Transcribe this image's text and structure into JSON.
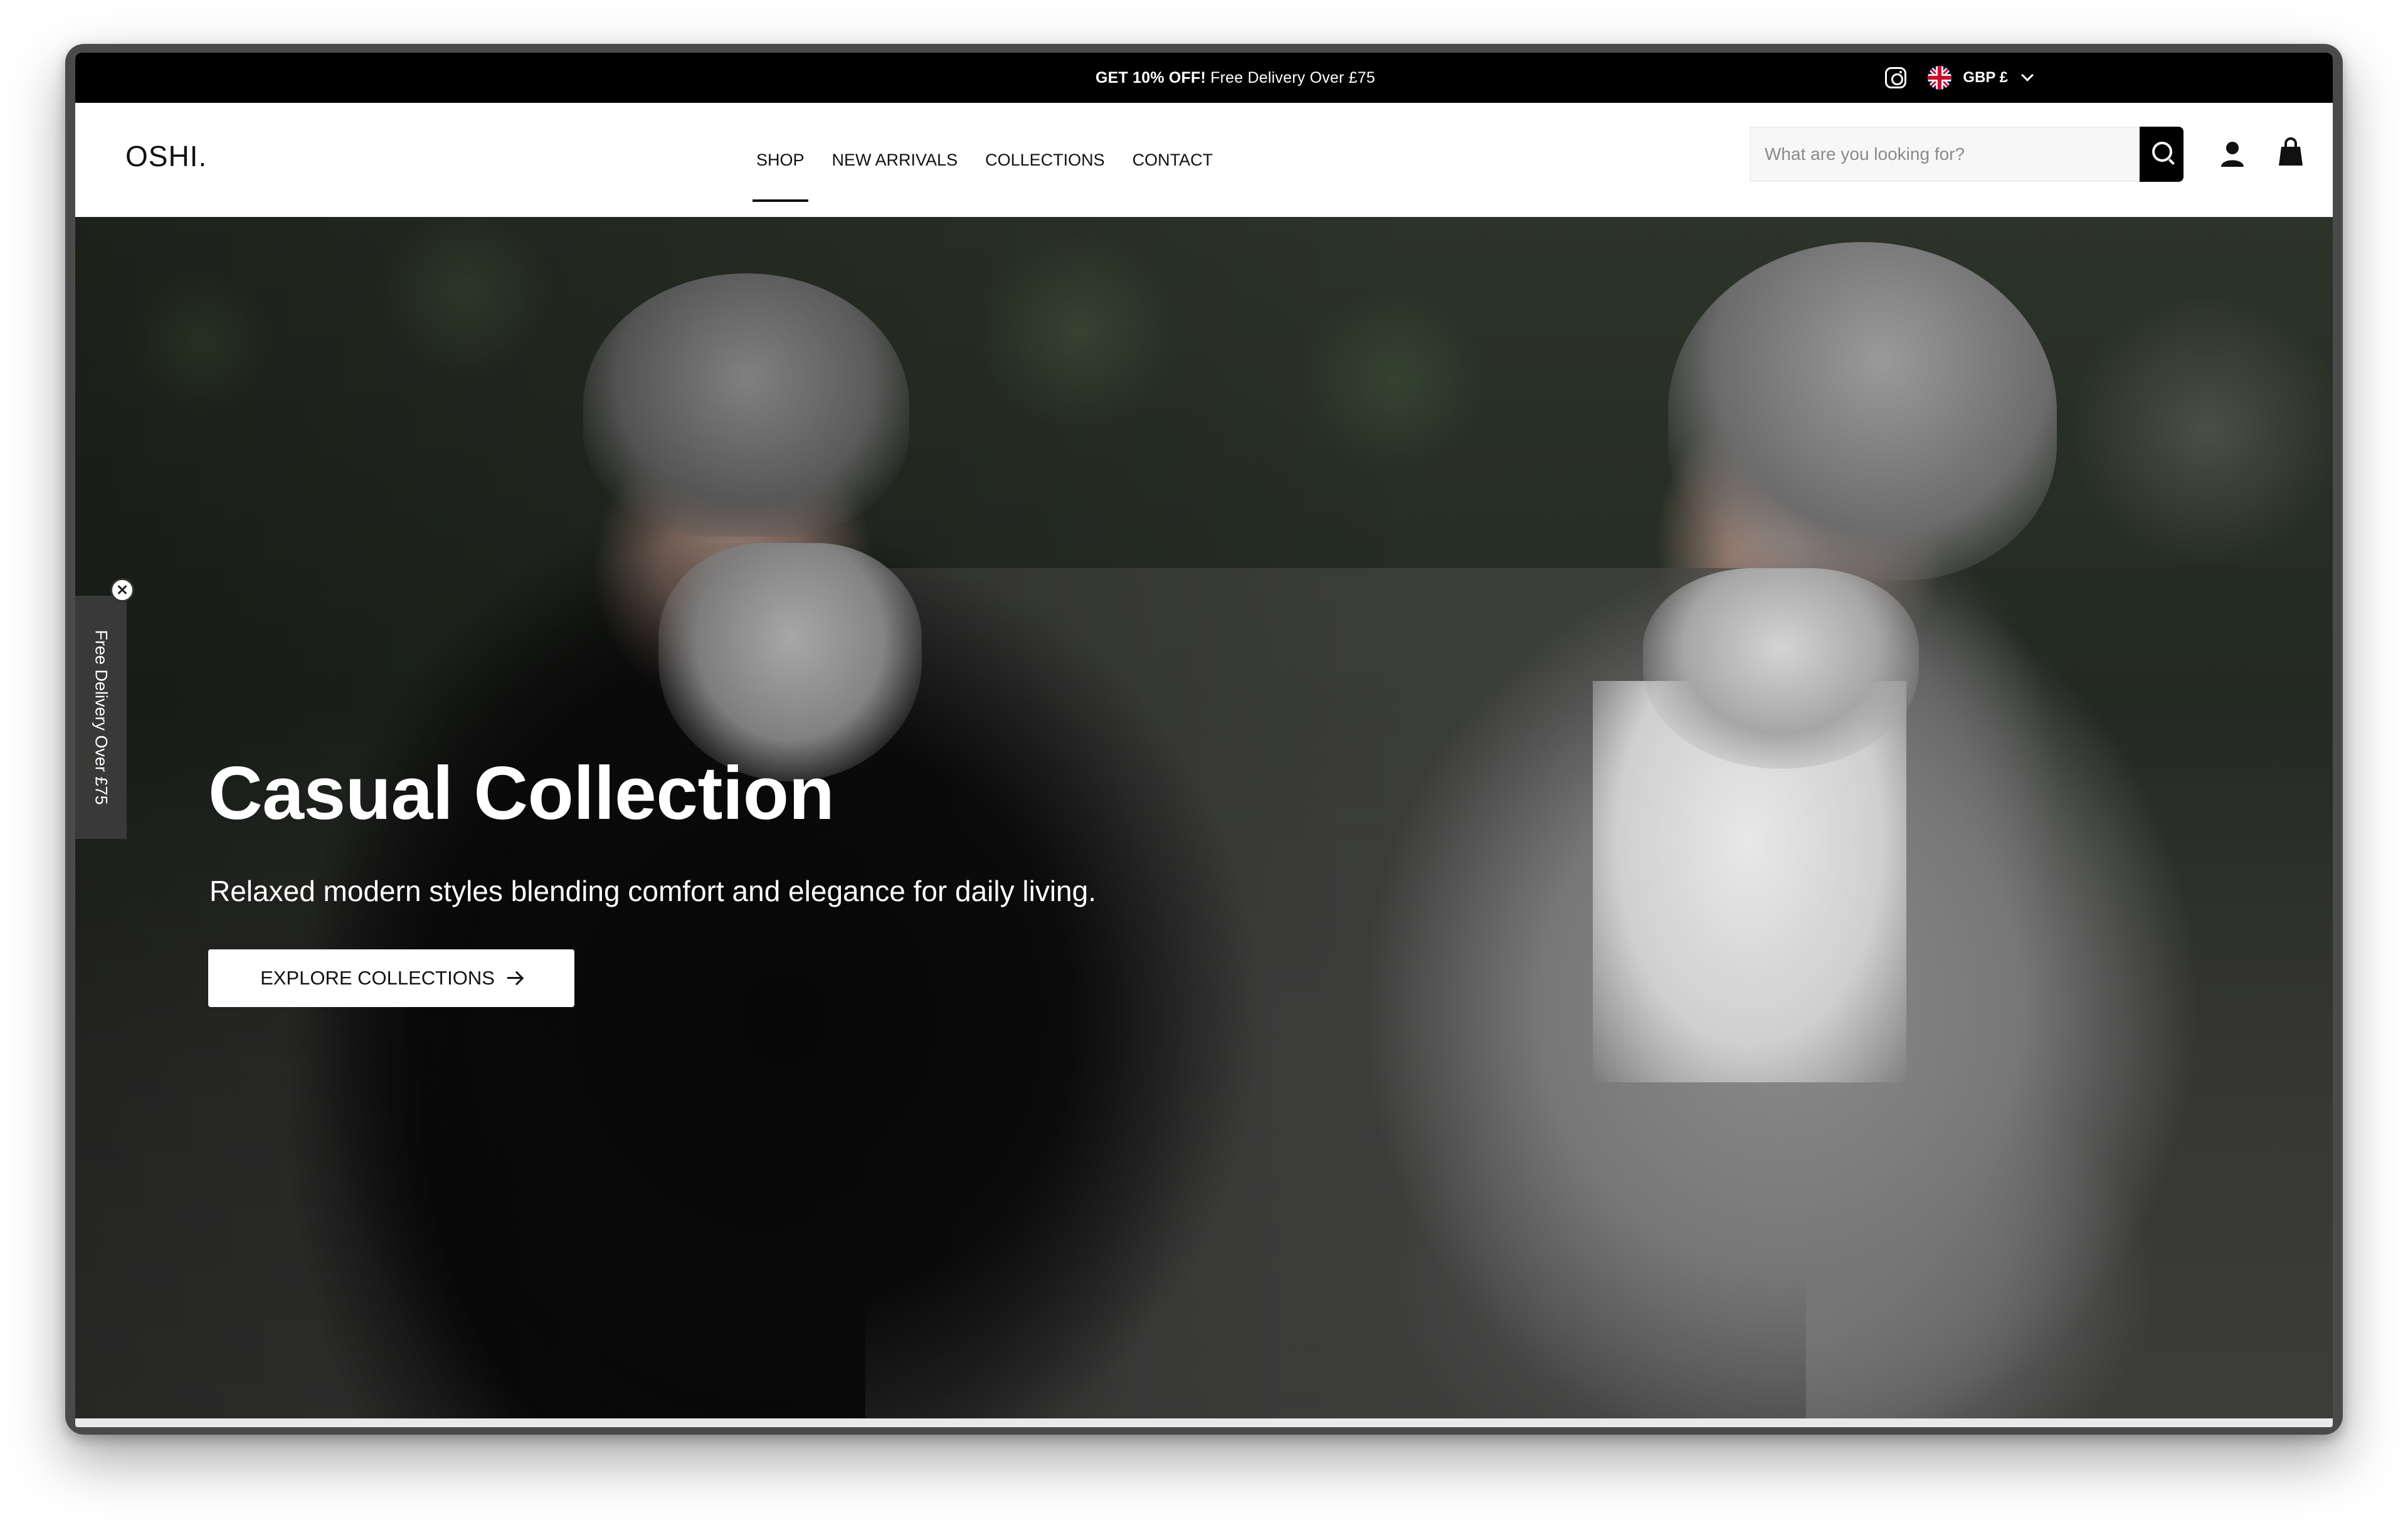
{
  "announcement": {
    "bold": "GET 10% OFF!",
    "text": "Free Delivery Over £75"
  },
  "currency": {
    "label": "GBP £"
  },
  "header": {
    "logo": "OSHI.",
    "nav": [
      {
        "label": "SHOP",
        "active": true
      },
      {
        "label": "NEW ARRIVALS",
        "active": false
      },
      {
        "label": "COLLECTIONS",
        "active": false
      },
      {
        "label": "CONTACT",
        "active": false
      }
    ],
    "search": {
      "placeholder": "What are you looking for?",
      "value": ""
    }
  },
  "hero": {
    "title": "Casual Collection",
    "subtitle": "Relaxed modern styles blending comfort and elegance for daily living.",
    "cta_label": "EXPLORE COLLECTIONS"
  },
  "side_tab": {
    "label": "Free Delivery Over £75"
  },
  "colors": {
    "announcement_bg": "#000000",
    "accent": "#000000",
    "text": "#111111",
    "cta_bg": "#ffffff"
  },
  "icons": [
    "instagram-icon",
    "uk-flag-icon",
    "chevron-down-icon",
    "search-icon",
    "account-icon",
    "cart-icon",
    "arrow-right-icon",
    "close-icon"
  ]
}
